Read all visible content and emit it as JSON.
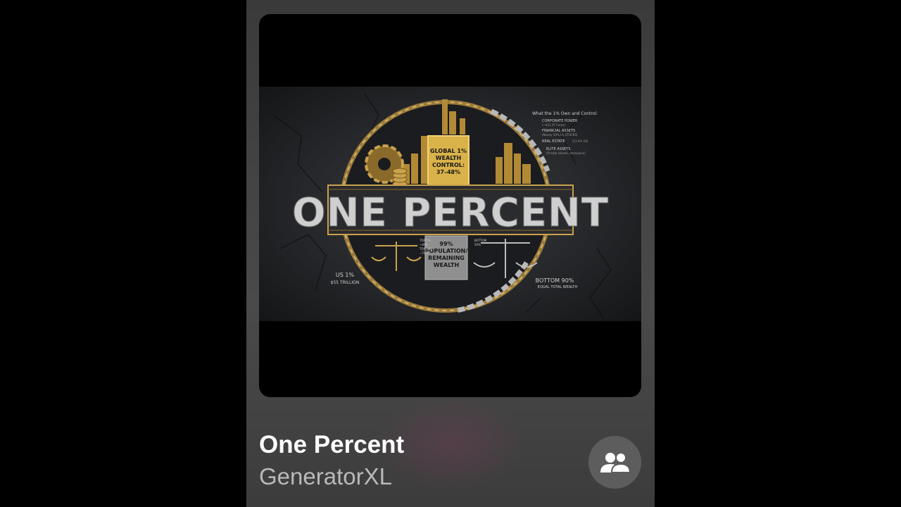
{
  "track": {
    "title": "One Percent",
    "artist": "GeneratorXL"
  },
  "artwork": {
    "headline": "ONE PERCENT",
    "top_box": [
      "GLOBAL 1%",
      "WEALTH",
      "CONTROL:",
      "37–48%"
    ],
    "bottom_box": [
      "99%",
      "POPULATION/",
      "REMAINING",
      "WEALTH"
    ],
    "right_heading": "What the 1% Own and Control:",
    "right_items": [
      {
        "label": "CORPORATE POWER",
        "sub": "(~$13.3T Corps)"
      },
      {
        "label": "FINANCIAL ASSETS",
        "sub": "(Nearly 50% US STOCKS)"
      },
      {
        "label": "REAL ESTATE",
        "sub": "(13.9% US)"
      },
      {
        "label": "ELITE ASSETS",
        "sub": "(Private Islands, Aerospace)"
      }
    ],
    "left_label": [
      "US 1%",
      "$55 TRILLION"
    ],
    "right_label": [
      "BOTTOM 90%",
      "EQUAL TOTAL WEALTH"
    ],
    "scale_left_text": [
      "TOP 1%",
      "~40%",
      "TOP 10%",
      "~70%"
    ],
    "scale_right_text": [
      "BOTTOM",
      "50%"
    ]
  },
  "colors": {
    "gold": "#d9b24a",
    "silver": "#c9c9c9"
  },
  "icons": {
    "share": "people-icon"
  }
}
